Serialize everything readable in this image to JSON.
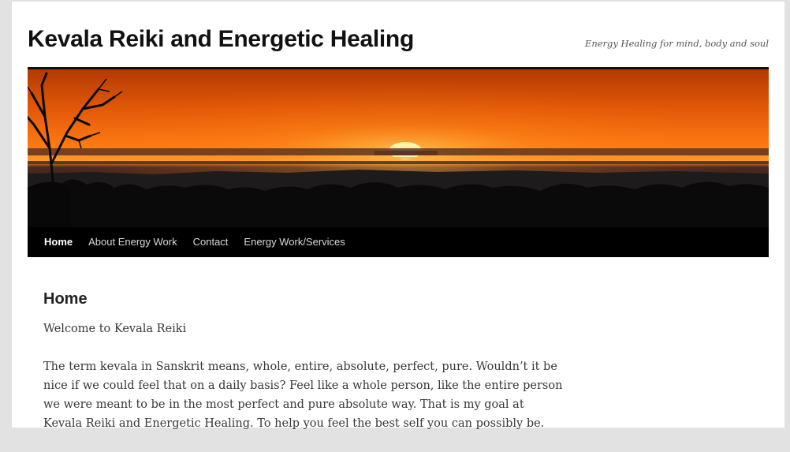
{
  "site": {
    "title": "Kevala Reiki and Energetic Healing",
    "description": "Energy Healing for mind, body and soul"
  },
  "banner": {
    "image": "sunset-over-savanna"
  },
  "nav": {
    "items": [
      {
        "label": "Home",
        "current": true
      },
      {
        "label": "About Energy Work",
        "current": false
      },
      {
        "label": "Contact",
        "current": false
      },
      {
        "label": "Energy Work/Services",
        "current": false
      }
    ]
  },
  "page": {
    "title": "Home",
    "paragraphs": [
      "Welcome to Kevala Reiki",
      "The term kevala in Sanskrit means, whole, entire, absolute, perfect, pure.  Wouldn’t it be nice if we could feel that on a daily basis?  Feel like a whole person, like the entire person we were meant to be in the most perfect and pure absolute way. That is my goal at Kevala Reiki and Energetic Healing. To help you feel the best self you can possibly be."
    ]
  },
  "colors": {
    "page_background": "#e2e2e2",
    "content_background": "#ffffff",
    "navbar": "#000000",
    "sky_top": "#cf4a06",
    "sky_horizon": "#ff8d18",
    "sun": "#fff3a8"
  }
}
